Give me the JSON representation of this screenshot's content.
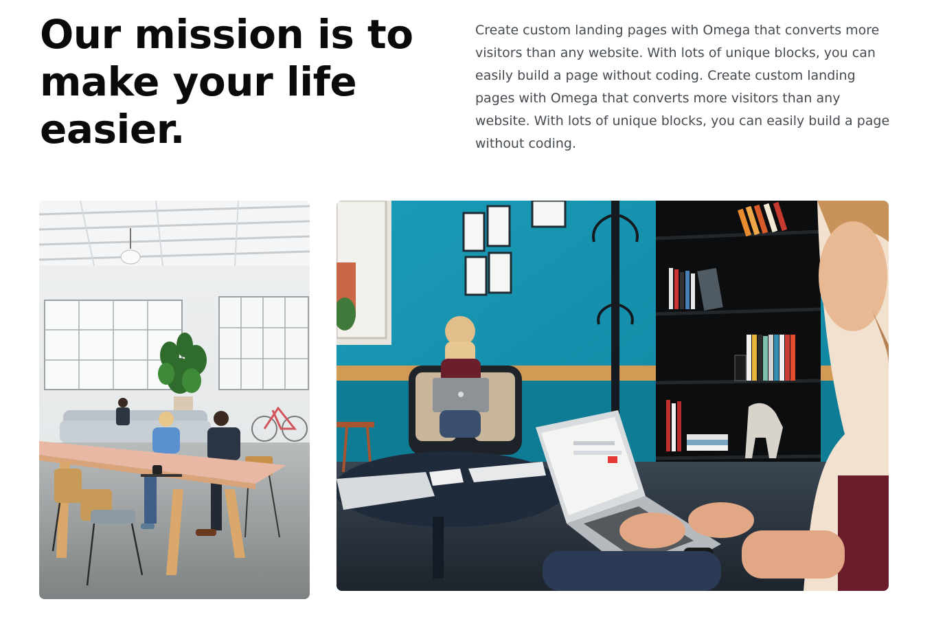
{
  "mission": {
    "heading": "Our mission is to make your life easier.",
    "description": "Create custom landing pages with Omega that converts more visitors than any website. With lots of unique blocks, you can easily build a page without coding. Create custom landing pages with Omega that converts more visitors than any website. With lots of unique blocks, you can easily build a page without coding."
  },
  "photos": [
    {
      "name": "office-coworking-photo"
    },
    {
      "name": "lounge-laptop-photo"
    }
  ]
}
